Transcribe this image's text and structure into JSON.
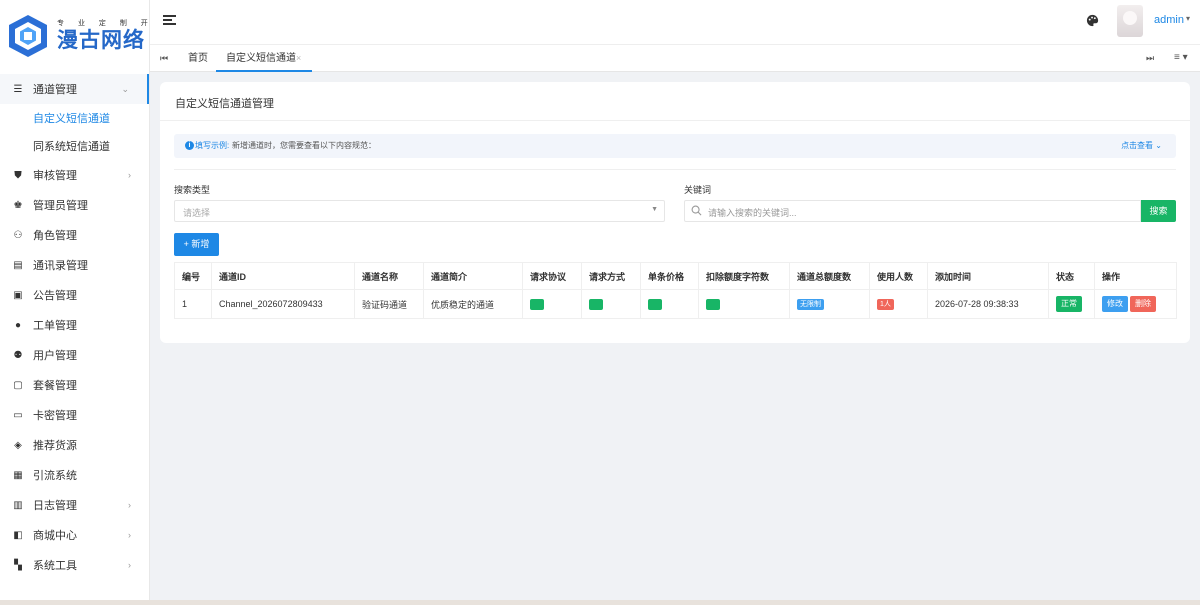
{
  "brand": {
    "tagline": "专 业 定 制 开 发",
    "name": "漫古网络"
  },
  "sidebar": {
    "items": [
      {
        "label": "通道管理",
        "icon": "list-icon",
        "open": true,
        "has_arrow": true,
        "children": [
          {
            "label": "自定义短信通道",
            "active": true
          },
          {
            "label": "同系统短信通道",
            "active": false
          }
        ]
      },
      {
        "label": "审核管理",
        "icon": "shield-icon",
        "has_arrow": true
      },
      {
        "label": "管理员管理",
        "icon": "admin-icon",
        "has_arrow": false
      },
      {
        "label": "角色管理",
        "icon": "users-icon",
        "has_arrow": false
      },
      {
        "label": "通讯录管理",
        "icon": "contact-card-icon",
        "has_arrow": false
      },
      {
        "label": "公告管理",
        "icon": "notice-icon",
        "has_arrow": false
      },
      {
        "label": "工单管理",
        "icon": "chat-icon",
        "has_arrow": false
      },
      {
        "label": "用户管理",
        "icon": "group-icon",
        "has_arrow": false
      },
      {
        "label": "套餐管理",
        "icon": "package-icon",
        "has_arrow": false
      },
      {
        "label": "卡密管理",
        "icon": "card-icon",
        "has_arrow": false
      },
      {
        "label": "推荐货源",
        "icon": "recommend-icon",
        "has_arrow": false
      },
      {
        "label": "引流系统",
        "icon": "gift-icon",
        "has_arrow": false
      },
      {
        "label": "日志管理",
        "icon": "calendar-icon",
        "has_arrow": true
      },
      {
        "label": "商城中心",
        "icon": "shop-icon",
        "has_arrow": true
      },
      {
        "label": "系统工具",
        "icon": "grid-icon",
        "has_arrow": true
      }
    ]
  },
  "header": {
    "username": "admin"
  },
  "tabs": {
    "home": "首页",
    "current": "自定义短信通道"
  },
  "page": {
    "title": "自定义短信通道管理",
    "notice_label": "填写示例:",
    "notice_text": "新增通道时，您需要查看以下内容规范：",
    "notice_link": "点击查看",
    "search_type_label": "搜索类型",
    "search_type_placeholder": "请选择",
    "keyword_label": "关键词",
    "keyword_placeholder": "请输入搜索的关键词...",
    "search_button": "搜索",
    "add_button": "+ 新增"
  },
  "table": {
    "columns": [
      "编号",
      "通道ID",
      "通道名称",
      "通道简介",
      "请求协议",
      "请求方式",
      "单条价格",
      "扣除额度字符数",
      "通道总额度数",
      "使用人数",
      "添加时间",
      "状态",
      "操作"
    ],
    "rows": [
      {
        "id": "1",
        "channel_id": "Channel_2026072809433",
        "name": "验证码通道",
        "intro": "优质稳定的通道",
        "protocol": "",
        "method": "",
        "price": "",
        "deduct_chars": "",
        "total_quota": "无限制",
        "users": "1人",
        "added": "2026-07-28 09:38:33",
        "status": "正常",
        "edit": "修改",
        "delete": "删除"
      }
    ]
  },
  "colors": {
    "primary": "#1e88e5",
    "success": "#18b566",
    "danger": "#f0665a"
  }
}
